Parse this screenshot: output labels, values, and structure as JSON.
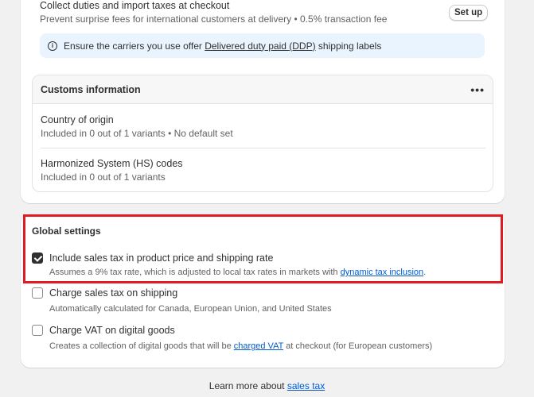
{
  "duties": {
    "title": "Collect duties and import taxes at checkout",
    "description": "Prevent surprise fees for international customers at delivery • 0.5% transaction fee",
    "setup_button": "Set up",
    "banner": {
      "icon": "info-icon",
      "prefix": "Ensure the carriers you use offer ",
      "link": "Delivered duty paid (DDP)",
      "suffix": " shipping labels"
    }
  },
  "customs": {
    "title": "Customs information",
    "menu_icon": "more-horizontal-icon",
    "rows": [
      {
        "title": "Country of origin",
        "subtitle": "Included in 0 out of 1 variants • No default set"
      },
      {
        "title": "Harmonized System (HS) codes",
        "subtitle": "Included in 0 out of 1 variants"
      }
    ]
  },
  "global_settings": {
    "title": "Global settings",
    "options": [
      {
        "label": "Include sales tax in product price and shipping rate",
        "checked": true,
        "help_prefix": "Assumes a 9% tax rate, which is adjusted to local tax rates in markets with ",
        "help_link": "dynamic tax inclusion",
        "help_suffix": "."
      },
      {
        "label": "Charge sales tax on shipping",
        "checked": false,
        "help": "Automatically calculated for Canada, European Union, and United States"
      },
      {
        "label": "Charge VAT on digital goods",
        "checked": false,
        "help_prefix": "Creates a collection of digital goods that will be ",
        "help_link": "charged VAT",
        "help_suffix": " at checkout (for European customers)"
      }
    ]
  },
  "footer": {
    "prefix": "Learn more about ",
    "link": "sales tax"
  },
  "colors": {
    "highlight": "#e01b24",
    "link": "#005bd3",
    "banner_bg": "#eaf4ff"
  }
}
